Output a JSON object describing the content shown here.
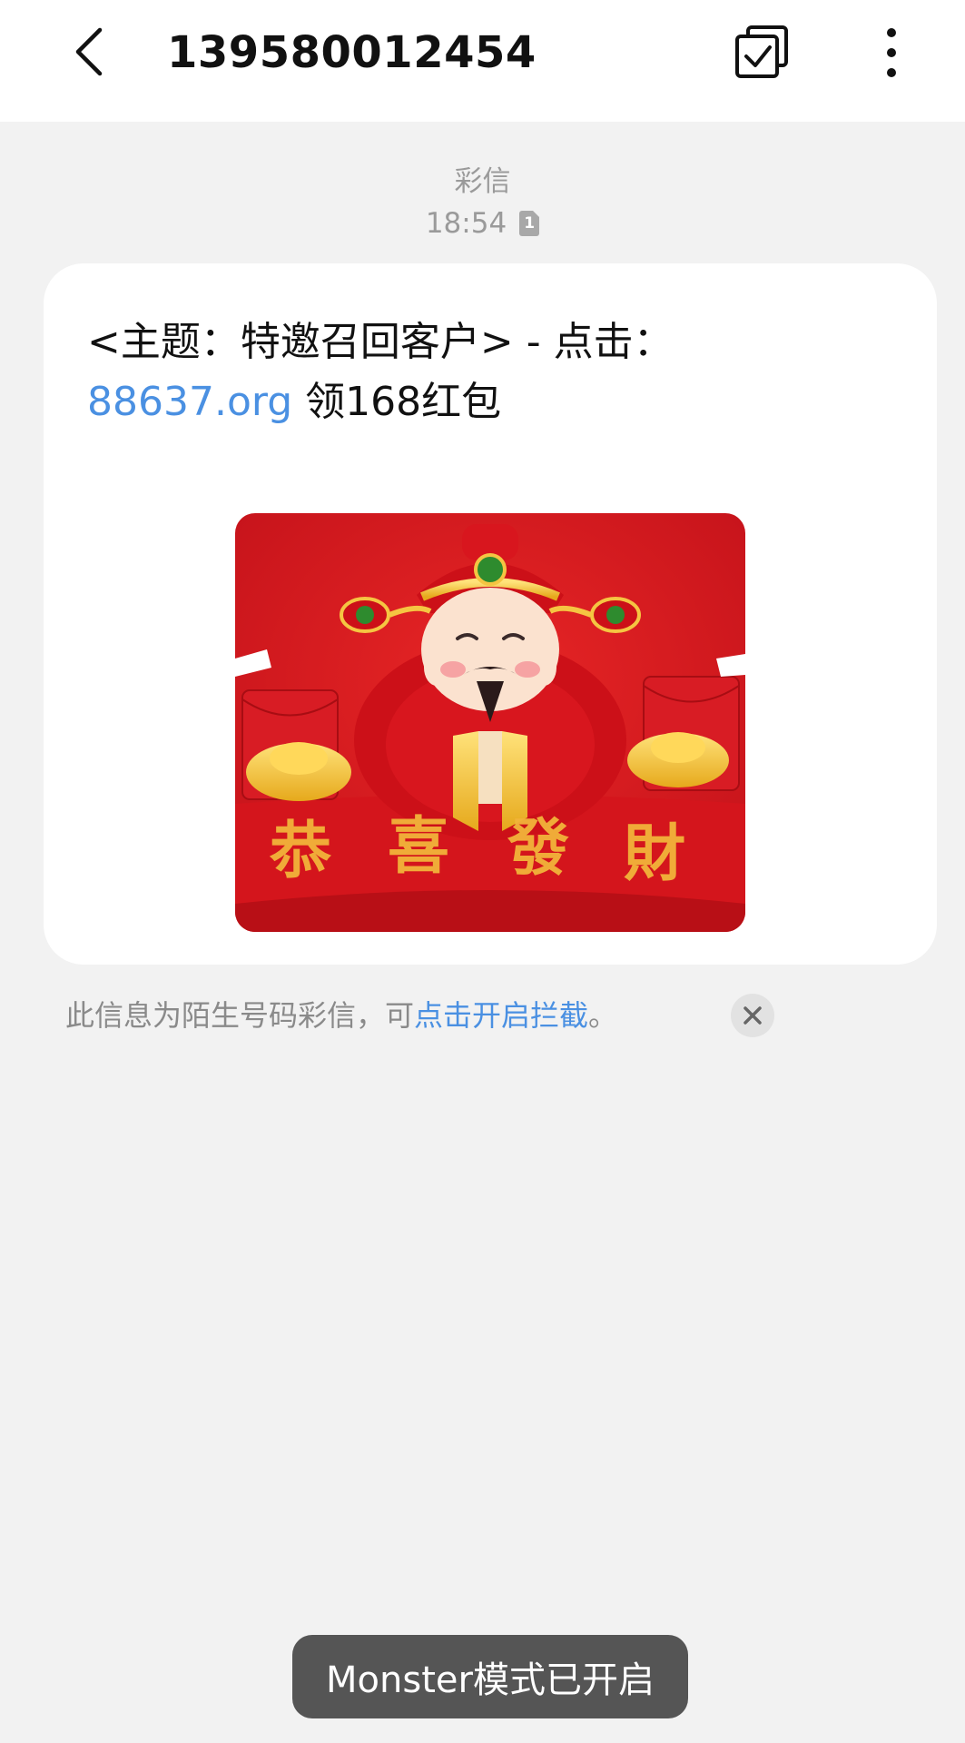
{
  "header": {
    "title": "139580012454",
    "back_icon": "chevron-left-icon",
    "select_icon": "multi-select-icon",
    "more_icon": "more-vertical-icon"
  },
  "message": {
    "type_label": "彩信",
    "time": "18:54",
    "sim_slot": "1",
    "text_part1": "<主题：特邀召回客户> - 点击：",
    "link_text": "88637.org",
    "text_part2": " 领168红包",
    "image_caption": "恭喜發財"
  },
  "notice": {
    "text_before": "此信息为陌生号码彩信，可",
    "link_text": "点击开启拦截",
    "text_after": "。",
    "close_icon": "close-icon"
  },
  "toast": {
    "text": "Monster模式已开启"
  },
  "colors": {
    "background": "#f2f2f2",
    "link": "#4a90e2",
    "toast_bg": "#555555",
    "image_red": "#d81c1c",
    "gold": "#f5c542"
  }
}
